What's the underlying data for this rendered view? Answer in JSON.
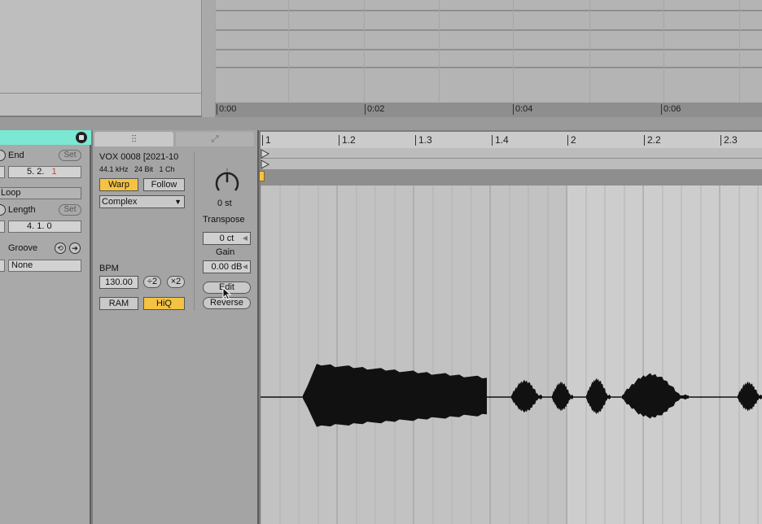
{
  "arrangement": {
    "time_labels": [
      "0:00",
      "0:02",
      "0:04",
      "0:06"
    ]
  },
  "clip": {
    "end_label": "End",
    "set_label": "Set",
    "end_value": "5.   2.",
    "end_value_red": "1",
    "loop_label": "Loop",
    "length_label": "Length",
    "length_value": "4.   1.   0",
    "groove_label": "Groove",
    "groove_value": "None"
  },
  "sample": {
    "name": "VOX 0008 [2021-10",
    "info": "44.1 kHz   24 Bit   1 Ch",
    "warp_label": "Warp",
    "follow_label": "Follow",
    "warp_mode": "Complex",
    "bpm_label": "BPM",
    "bpm_value": "130.00",
    "half_label": "÷2",
    "double_label": "×2",
    "ram_label": "RAM",
    "hiq_label": "HiQ",
    "transpose_value": "0 st",
    "transpose_label": "Transpose",
    "detune_value": "0 ct",
    "gain_label": "Gain",
    "gain_value": "0.00 dB",
    "edit_label": "Edit",
    "reverse_label": "Reverse"
  },
  "ruler": {
    "bars": [
      "1",
      "1.2",
      "1.3",
      "1.4",
      "2",
      "2.2",
      "2.3"
    ]
  },
  "colors": {
    "clip_header": "#7ae8d3",
    "button_on": "#f4c344",
    "waveform": "#111111"
  },
  "icons": {
    "tab_sample": "waveform-icon",
    "tab_envelope": "envelope-icon",
    "cursor": "mouse-pointer-icon"
  }
}
